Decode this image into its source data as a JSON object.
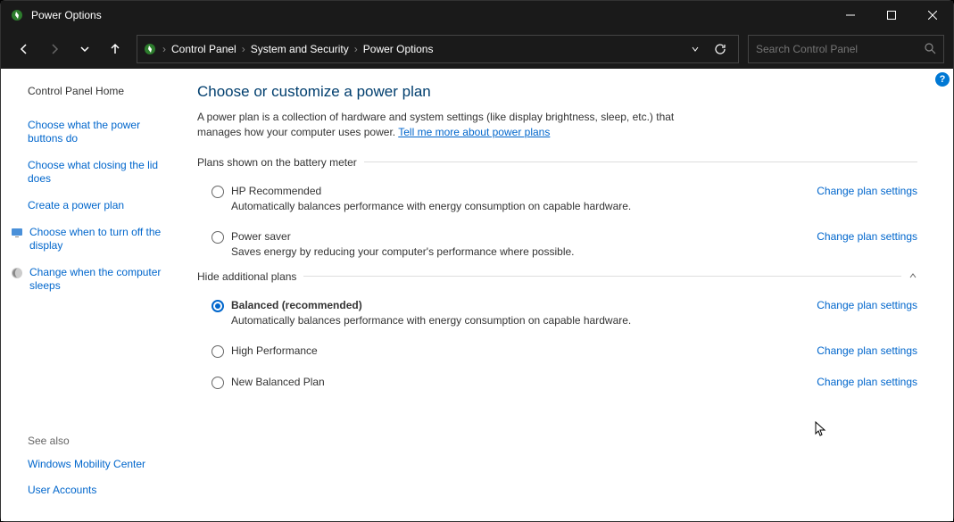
{
  "window": {
    "title": "Power Options"
  },
  "breadcrumb": {
    "items": [
      "Control Panel",
      "System and Security",
      "Power Options"
    ]
  },
  "search": {
    "placeholder": "Search Control Panel"
  },
  "sidebar": {
    "home": "Control Panel Home",
    "links": [
      "Choose what the power buttons do",
      "Choose what closing the lid does",
      "Create a power plan",
      "Choose when to turn off the display",
      "Change when the computer sleeps"
    ],
    "see_also_label": "See also",
    "see_also": [
      "Windows Mobility Center",
      "User Accounts"
    ]
  },
  "main": {
    "title": "Choose or customize a power plan",
    "description": "A power plan is a collection of hardware and system settings (like display brightness, sleep, etc.) that manages how your computer uses power.",
    "learn_more": "Tell me more about power plans",
    "section1_label": "Plans shown on the battery meter",
    "section2_label": "Hide additional plans",
    "change_settings_label": "Change plan settings",
    "plans_battery": [
      {
        "name": "HP Recommended",
        "desc": "Automatically balances performance with energy consumption on capable hardware.",
        "selected": false
      },
      {
        "name": "Power saver",
        "desc": "Saves energy by reducing your computer's performance where possible.",
        "selected": false
      }
    ],
    "plans_additional": [
      {
        "name": "Balanced (recommended)",
        "desc": "Automatically balances performance with energy consumption on capable hardware.",
        "selected": true
      },
      {
        "name": "High Performance",
        "desc": "",
        "selected": false
      },
      {
        "name": "New Balanced Plan",
        "desc": "",
        "selected": false
      }
    ]
  }
}
